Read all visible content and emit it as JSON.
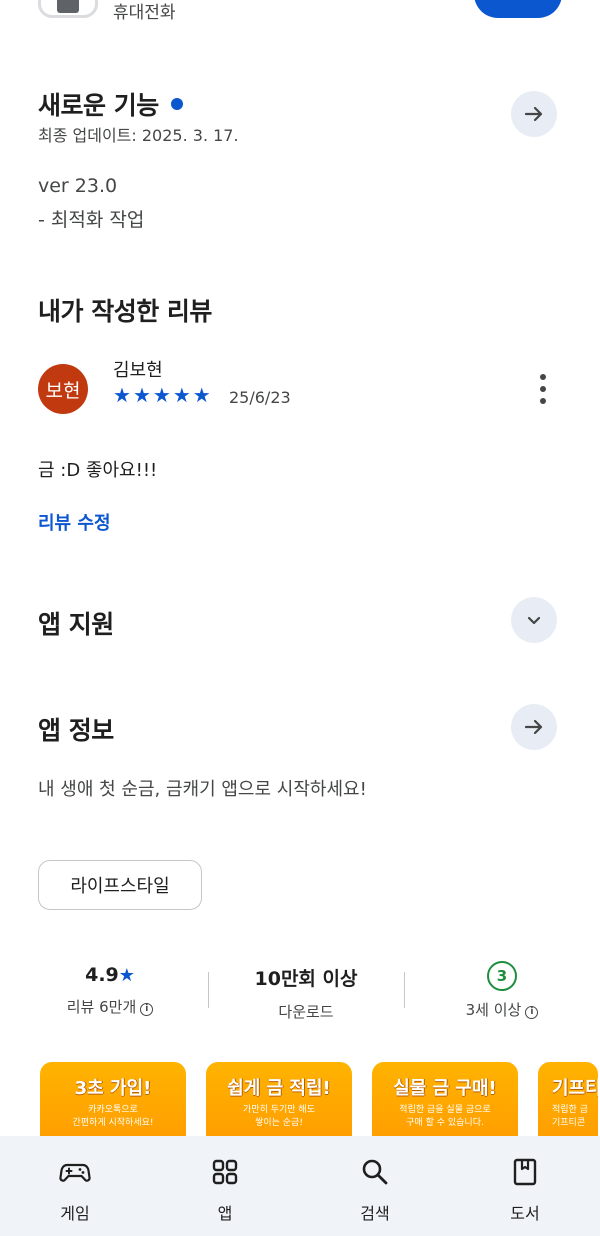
{
  "top": {
    "category": "휴대전화"
  },
  "whats_new": {
    "title": "새로운 기능",
    "updated": "최종 업데이트: 2025. 3. 17.",
    "line1": "ver 23.0",
    "line2": "- 최적화 작업"
  },
  "my_review": {
    "title": "내가 작성한 리뷰",
    "avatar_text": "보현",
    "author": "김보현",
    "stars": 5,
    "date": "25/6/23",
    "body": "금 :D 좋아요!!!",
    "edit_label": "리뷰 수정"
  },
  "app_support": {
    "title": "앱 지원"
  },
  "app_info": {
    "title": "앱 정보",
    "description": "내 생애 첫 순금, 금캐기 앱으로 시작하세요!",
    "category_chip": "라이프스타일"
  },
  "stats": {
    "rating": "4.9",
    "reviews": "리뷰 6만개",
    "downloads": "10만회 이상",
    "downloads_label": "다운로드",
    "age_badge": "3",
    "age_label": "3세 이상"
  },
  "screenshots": [
    {
      "headline": "3초 가입!",
      "sub1": "카카오톡으로",
      "sub2": "간편하게 시작하세요!"
    },
    {
      "headline": "쉽게 금 적립!",
      "sub1": "가만히 두기만 해도",
      "sub2": "쌓이는 순금!"
    },
    {
      "headline": "실물 금 구매!",
      "sub1": "적립한 금을 실물 금으로",
      "sub2": "구매 할 수 있습니다."
    },
    {
      "headline": "기프티",
      "sub1": "적립한 금",
      "sub2": "기프티콘"
    }
  ],
  "bottom_nav": {
    "games": "게임",
    "apps": "앱",
    "search": "검색",
    "books": "도서"
  },
  "colors": {
    "accent": "#0b57d0",
    "avatar_bg": "#c0390f",
    "age_green": "#1e8e3e",
    "nav_bg": "#f0f4f9"
  }
}
